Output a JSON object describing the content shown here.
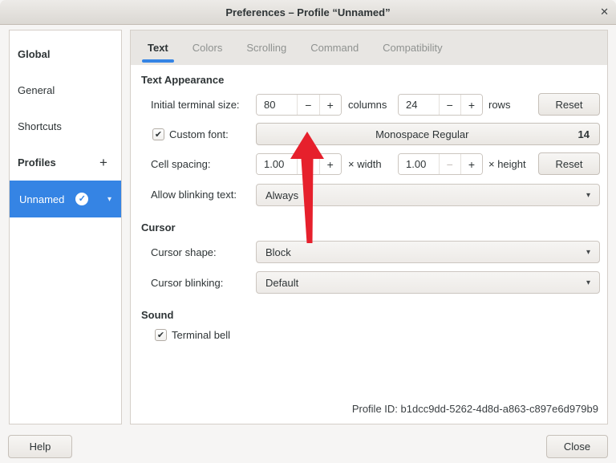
{
  "titlebar": {
    "title": "Preferences – Profile “Unnamed”"
  },
  "glyphs": {
    "close": "✕",
    "minus": "−",
    "plus": "+",
    "chevron_down": "▾",
    "checkmark": "✔",
    "profile_check": "✓",
    "add": "+"
  },
  "sidebar": {
    "global_header": "Global",
    "items": [
      {
        "label": "General"
      },
      {
        "label": "Shortcuts"
      }
    ],
    "profiles_header": "Profiles",
    "selected_profile": {
      "label": "Unnamed"
    }
  },
  "tabs": [
    {
      "label": "Text",
      "active": true
    },
    {
      "label": "Colors"
    },
    {
      "label": "Scrolling"
    },
    {
      "label": "Command"
    },
    {
      "label": "Compatibility"
    }
  ],
  "text_appearance": {
    "header": "Text Appearance",
    "initial_size": {
      "label": "Initial terminal size:",
      "columns_value": "80",
      "columns_unit": "columns",
      "rows_value": "24",
      "rows_unit": "rows",
      "reset_label": "Reset"
    },
    "custom_font": {
      "label": "Custom font:",
      "checked": true,
      "font_name": "Monospace Regular",
      "font_size": "14"
    },
    "cell_spacing": {
      "label": "Cell spacing:",
      "width_value": "1.00",
      "width_unit": "× width",
      "height_value": "1.00",
      "height_unit": "× height",
      "reset_label": "Reset"
    },
    "blinking": {
      "label": "Allow blinking text:",
      "value": "Always"
    }
  },
  "cursor": {
    "header": "Cursor",
    "shape": {
      "label": "Cursor shape:",
      "value": "Block"
    },
    "blinking": {
      "label": "Cursor blinking:",
      "value": "Default"
    }
  },
  "sound": {
    "header": "Sound",
    "terminal_bell": {
      "label": "Terminal bell",
      "checked": true
    }
  },
  "footer": {
    "profile_id_label": "Profile ID:",
    "profile_id_value": "b1dcc9dd-5262-4d8d-a863-c897e6d979b9",
    "profile_id_text": "Profile ID:  b1dcc9dd-5262-4d8d-a863-c897e6d979b9"
  },
  "actions": {
    "help_label": "Help",
    "close_label": "Close"
  },
  "colors": {
    "accent": "#3584e4",
    "arrow_red": "#e6202c",
    "selected_bg": "#3584e4"
  }
}
